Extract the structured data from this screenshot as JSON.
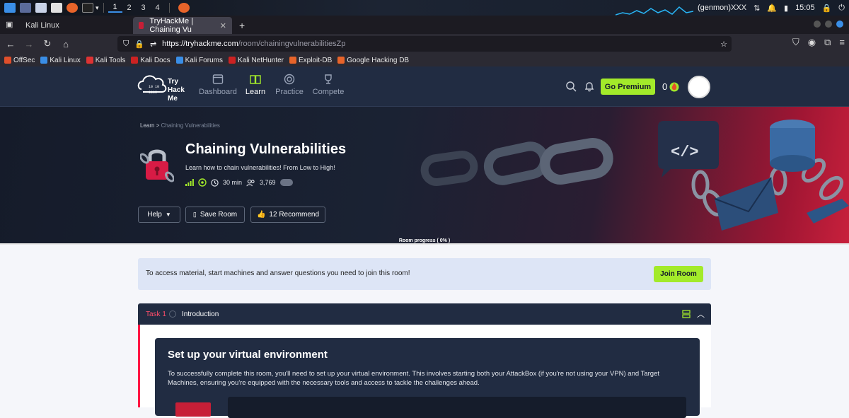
{
  "os_taskbar": {
    "workspaces": [
      "1",
      "2",
      "3",
      "4"
    ],
    "genmon": "(genmon)XXX",
    "clock": "15:05"
  },
  "browser": {
    "tabs": [
      {
        "label": "Kali Linux"
      },
      {
        "label": "TryHackMe | Chaining Vu"
      }
    ],
    "new_tab": "+",
    "url_prefix": "https://tryhackme.com",
    "url_path": "/room/chainingvulnerabilitiesZp",
    "bookmarks": [
      "OffSec",
      "Kali Linux",
      "Kali Tools",
      "Kali Docs",
      "Kali Forums",
      "Kali NetHunter",
      "Exploit-DB",
      "Google Hacking DB"
    ]
  },
  "thm": {
    "logo_text": "Try Hack Me",
    "nav": [
      {
        "label": "Dashboard"
      },
      {
        "label": "Learn"
      },
      {
        "label": "Practice"
      },
      {
        "label": "Compete"
      }
    ],
    "premium_label": "Go Premium",
    "streak_count": "0"
  },
  "room": {
    "breadcrumb_root": "Learn",
    "breadcrumb_sep": ">",
    "breadcrumb_current": "Chaining Vulnerabilities",
    "title": "Chaining Vulnerabilities",
    "description": "Learn how to chain vulnerabilities! From Low to High!",
    "duration": "30 min",
    "users": "3,769",
    "buttons": {
      "help": "Help",
      "save": "Save Room",
      "recommend": "12 Recommend"
    },
    "progress_label": "Room progress ( 0% )",
    "progress_value": 0
  },
  "join_banner": {
    "text": "To access material, start machines and answer questions you need to join this room!",
    "button": "Join Room"
  },
  "task": {
    "number": "Task 1",
    "name": "Introduction"
  },
  "setup": {
    "title": "Set up your virtual environment",
    "text": "To successfully complete this room, you'll need to set up your virtual environment. This involves starting both your AttackBox (if you're not using your VPN) and Target Machines, ensuring you're equipped with the necessary tools and access to tackle the challenges ahead."
  },
  "colors": {
    "accent_green": "#a3ea2a",
    "nav_bg": "#212c42",
    "task_red": "#ff1744"
  }
}
